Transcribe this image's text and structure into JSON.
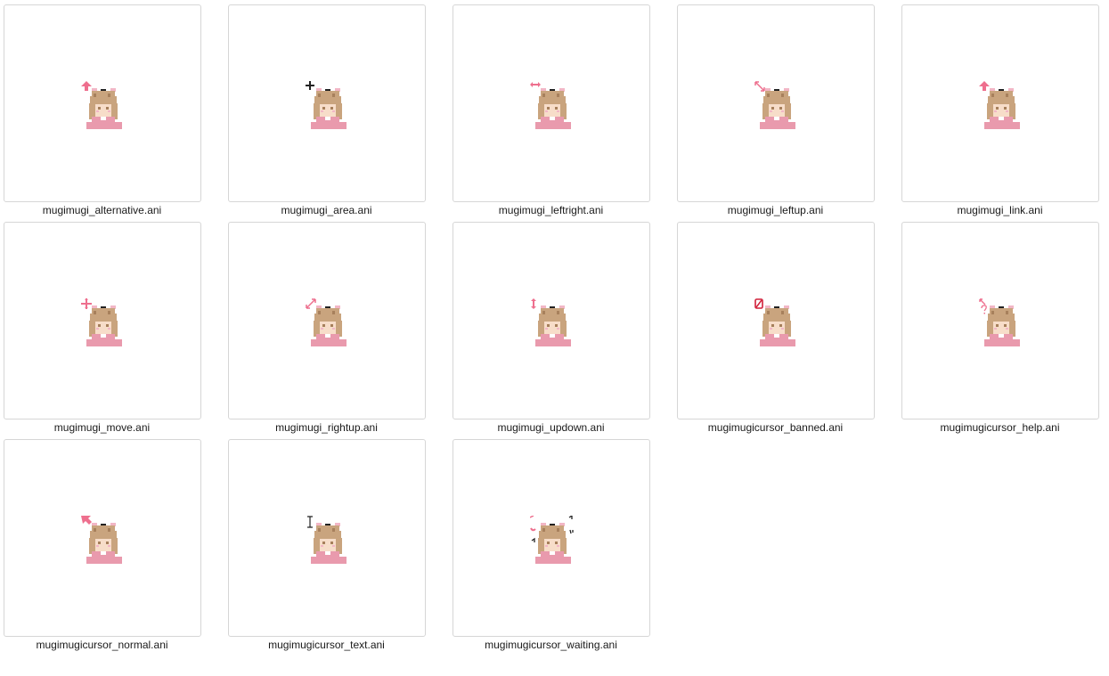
{
  "colors": {
    "hair": "#c9a47e",
    "hair_dark": "#a7805c",
    "skin": "#f7ddc9",
    "shirt": "#e99aad",
    "ears": "#f2b6c6",
    "accent_pink": "#ee6f8e",
    "banned_red": "#d1203a",
    "dark": "#222222"
  },
  "files": [
    {
      "name": "mugimugi_alternative.ani",
      "icon": "cursor-alternative-icon",
      "glyph": "arrow-up"
    },
    {
      "name": "mugimugi_area.ani",
      "icon": "cursor-area-icon",
      "glyph": "cross"
    },
    {
      "name": "mugimugi_leftright.ani",
      "icon": "cursor-leftright-icon",
      "glyph": "leftright"
    },
    {
      "name": "mugimugi_leftup.ani",
      "icon": "cursor-leftup-icon",
      "glyph": "diag-nw"
    },
    {
      "name": "mugimugi_link.ani",
      "icon": "cursor-link-icon",
      "glyph": "arrow-up"
    },
    {
      "name": "mugimugi_move.ani",
      "icon": "cursor-move-icon",
      "glyph": "move"
    },
    {
      "name": "mugimugi_rightup.ani",
      "icon": "cursor-rightup-icon",
      "glyph": "diag-ne"
    },
    {
      "name": "mugimugi_updown.ani",
      "icon": "cursor-updown-icon",
      "glyph": "updown"
    },
    {
      "name": "mugimugicursor_banned.ani",
      "icon": "cursor-banned-icon",
      "glyph": "banned"
    },
    {
      "name": "mugimugicursor_help.ani",
      "icon": "cursor-help-icon",
      "glyph": "help"
    },
    {
      "name": "mugimugicursor_normal.ani",
      "icon": "cursor-normal-icon",
      "glyph": "normal"
    },
    {
      "name": "mugimugicursor_text.ani",
      "icon": "cursor-text-icon",
      "glyph": "text"
    },
    {
      "name": "mugimugicursor_waiting.ani",
      "icon": "cursor-waiting-icon",
      "glyph": "waiting"
    }
  ]
}
